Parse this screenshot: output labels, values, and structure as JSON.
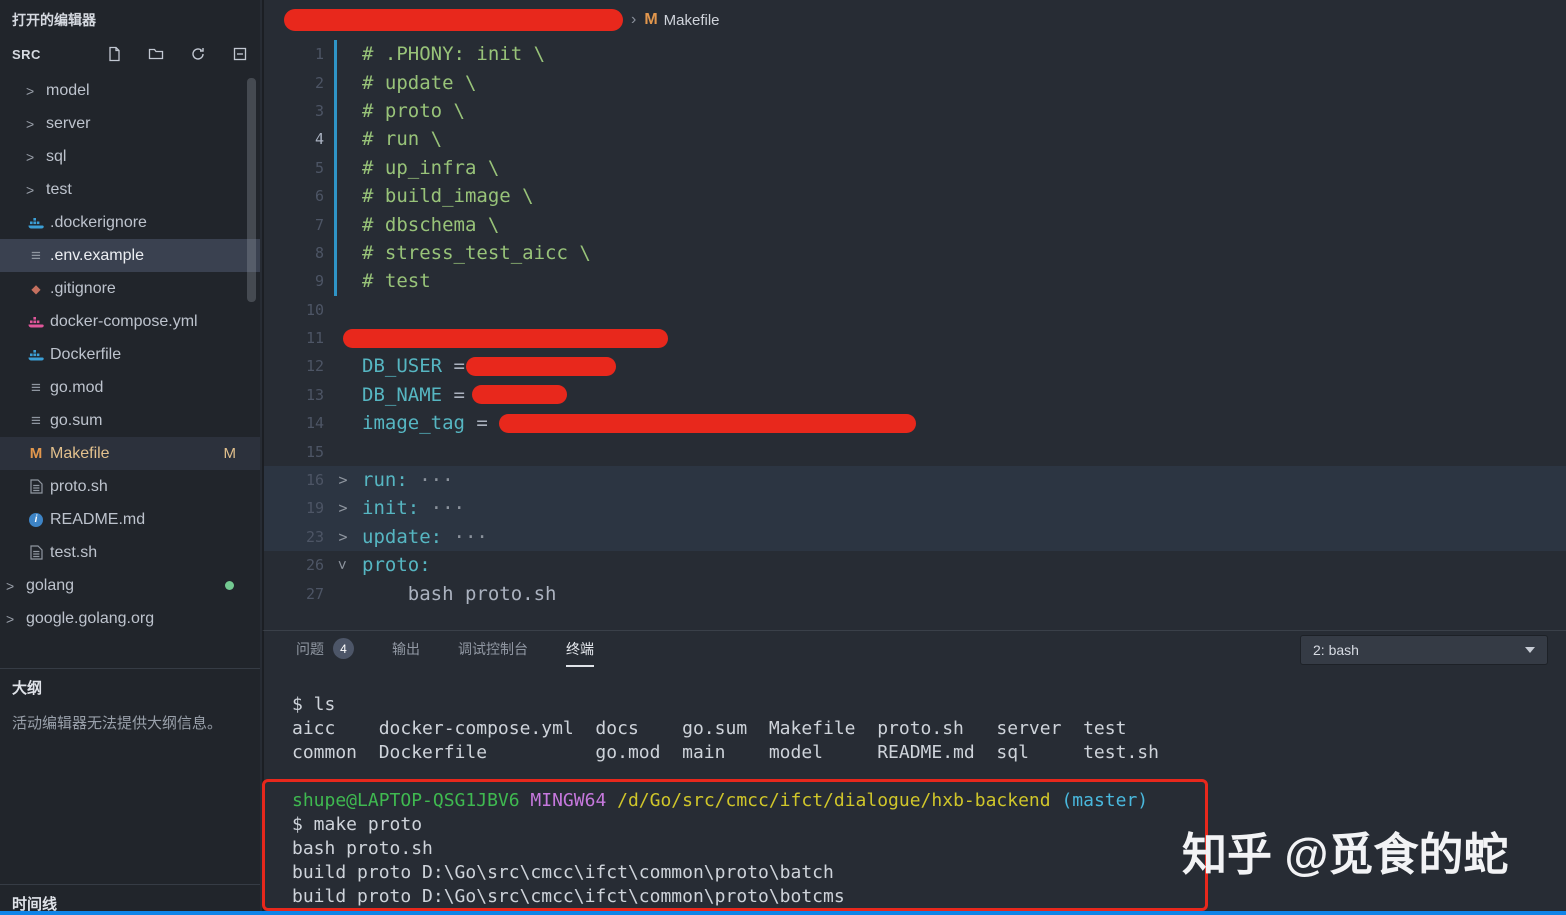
{
  "colors": {
    "marker_red": "#e8281c",
    "status_blue": "#0f84e8",
    "makefile_orange": "#e2974d",
    "modified_badge": "#e2c08d",
    "comment_green": "#98c379",
    "variable_cyan": "#56b6c2"
  },
  "sidebar": {
    "open_editors_label": "打开的编辑器",
    "section_title": "SRC",
    "tree": [
      {
        "label": "model",
        "kind": "folder",
        "indent": 1
      },
      {
        "label": "server",
        "kind": "folder",
        "indent": 1
      },
      {
        "label": "sql",
        "kind": "folder",
        "indent": 1
      },
      {
        "label": "test",
        "kind": "folder",
        "indent": 1
      },
      {
        "label": ".dockerignore",
        "icon": "docker",
        "indent": 1
      },
      {
        "label": ".env.example",
        "icon": "lines",
        "indent": 1,
        "selected": true
      },
      {
        "label": ".gitignore",
        "icon": "git",
        "indent": 1
      },
      {
        "label": "docker-compose.yml",
        "icon": "docker-pink",
        "indent": 1
      },
      {
        "label": "Dockerfile",
        "icon": "docker",
        "indent": 1
      },
      {
        "label": "go.mod",
        "icon": "lines",
        "indent": 1
      },
      {
        "label": "go.sum",
        "icon": "lines",
        "indent": 1
      },
      {
        "label": "Makefile",
        "icon": "makefile",
        "indent": 1,
        "active": true,
        "badge": "M"
      },
      {
        "label": "proto.sh",
        "icon": "file",
        "indent": 1
      },
      {
        "label": "README.md",
        "icon": "info",
        "indent": 1
      },
      {
        "label": "test.sh",
        "icon": "file",
        "indent": 1
      },
      {
        "label": "golang",
        "kind": "folder",
        "indent": 0,
        "dot": true
      },
      {
        "label": "google.golang.org",
        "kind": "folder",
        "indent": 0
      }
    ],
    "outline": {
      "title": "大纲",
      "message": "活动编辑器无法提供大纲信息。"
    },
    "timeline": {
      "title": "时间线"
    }
  },
  "breadcrumb": {
    "redacted": true,
    "separator": "›",
    "file_icon": "M",
    "file_label": "Makefile"
  },
  "editor": {
    "lines": [
      {
        "num": "1",
        "guide": true,
        "segs": [
          {
            "t": "# .PHONY: init \\",
            "c": "comment"
          }
        ]
      },
      {
        "num": "2",
        "guide": true,
        "segs": [
          {
            "t": "# update \\",
            "c": "comment"
          }
        ]
      },
      {
        "num": "3",
        "guide": true,
        "segs": [
          {
            "t": "# proto \\",
            "c": "comment"
          }
        ]
      },
      {
        "num": "4",
        "guide": true,
        "active": true,
        "segs": [
          {
            "t": "# run \\",
            "c": "comment"
          }
        ]
      },
      {
        "num": "5",
        "guide": true,
        "segs": [
          {
            "t": "# up_infra \\",
            "c": "comment"
          }
        ]
      },
      {
        "num": "6",
        "guide": true,
        "segs": [
          {
            "t": "# build_image \\",
            "c": "comment"
          }
        ]
      },
      {
        "num": "7",
        "guide": true,
        "segs": [
          {
            "t": "# dbschema \\",
            "c": "comment"
          }
        ]
      },
      {
        "num": "8",
        "guide": true,
        "segs": [
          {
            "t": "# stress_test_aicc \\",
            "c": "comment"
          }
        ]
      },
      {
        "num": "9",
        "guide": true,
        "segs": [
          {
            "t": "# test",
            "c": "comment"
          }
        ]
      },
      {
        "num": "10",
        "segs": []
      },
      {
        "num": "11",
        "segs": [
          {
            "r": 325,
            "ml": -19
          }
        ]
      },
      {
        "num": "12",
        "segs": [
          {
            "t": "DB_USER ",
            "c": "var"
          },
          {
            "t": "= ",
            "c": "plain"
          },
          {
            "r": 150,
            "ml": -10
          }
        ]
      },
      {
        "num": "13",
        "segs": [
          {
            "t": "DB_NAME ",
            "c": "var"
          },
          {
            "t": "= ",
            "c": "plain"
          },
          {
            "r": 95,
            "ml": -4
          }
        ]
      },
      {
        "num": "14",
        "segs": [
          {
            "t": "image_tag ",
            "c": "var"
          },
          {
            "t": "= ",
            "c": "plain"
          },
          {
            "r": 417
          }
        ]
      },
      {
        "num": "15",
        "segs": []
      },
      {
        "num": "16",
        "fold": "collapsed",
        "hl": true,
        "segs": [
          {
            "t": "run:",
            "c": "target"
          },
          {
            "t": " ···",
            "c": "dots"
          }
        ]
      },
      {
        "num": "19",
        "fold": "collapsed",
        "hl": true,
        "segs": [
          {
            "t": "init:",
            "c": "target"
          },
          {
            "t": " ···",
            "c": "dots"
          }
        ]
      },
      {
        "num": "23",
        "fold": "collapsed",
        "hl": true,
        "segs": [
          {
            "t": "update:",
            "c": "target"
          },
          {
            "t": " ···",
            "c": "dots"
          }
        ]
      },
      {
        "num": "26",
        "fold": "expanded",
        "segs": [
          {
            "t": "proto:",
            "c": "target"
          }
        ]
      },
      {
        "num": "27",
        "segs": [
          {
            "t": "    bash proto.sh",
            "c": "plain"
          }
        ]
      }
    ]
  },
  "panel": {
    "tabs": [
      {
        "label": "问题",
        "badge": "4"
      },
      {
        "label": "输出"
      },
      {
        "label": "调试控制台"
      },
      {
        "label": "终端",
        "active": true
      }
    ],
    "terminal_selector": "2: bash"
  },
  "terminal": {
    "lines": [
      {
        "segs": [
          {
            "t": "$ ls",
            "c": "plain"
          }
        ]
      },
      {
        "segs": [
          {
            "t": "aicc    docker-compose.yml  docs    go.sum  Makefile  proto.sh   server  test",
            "c": "plain"
          }
        ]
      },
      {
        "segs": [
          {
            "t": "common  Dockerfile          go.mod  main    model     README.md  sql     test.sh",
            "c": "plain"
          }
        ]
      },
      {
        "segs": []
      },
      {
        "segs": [
          {
            "t": "shupe@LAPTOP-QSG1JBV6 ",
            "c": "green"
          },
          {
            "t": "MINGW64 ",
            "c": "magenta"
          },
          {
            "t": "/d/Go/src/cmcc/ifct/dialogue/hxb-backend ",
            "c": "yellow"
          },
          {
            "t": "(master)",
            "c": "cyan"
          }
        ]
      },
      {
        "segs": [
          {
            "t": "$ make proto",
            "c": "plain"
          }
        ]
      },
      {
        "segs": [
          {
            "t": "bash proto.sh",
            "c": "plain"
          }
        ]
      },
      {
        "segs": [
          {
            "t": "build proto D:\\Go\\src\\cmcc\\ifct\\common\\proto\\batch",
            "c": "plain"
          }
        ]
      },
      {
        "segs": [
          {
            "t": "build proto D:\\Go\\src\\cmcc\\ifct\\common\\proto\\botcms",
            "c": "plain"
          }
        ]
      }
    ]
  },
  "watermark": {
    "brand": "知乎",
    "handle": "@觅食的蛇"
  }
}
